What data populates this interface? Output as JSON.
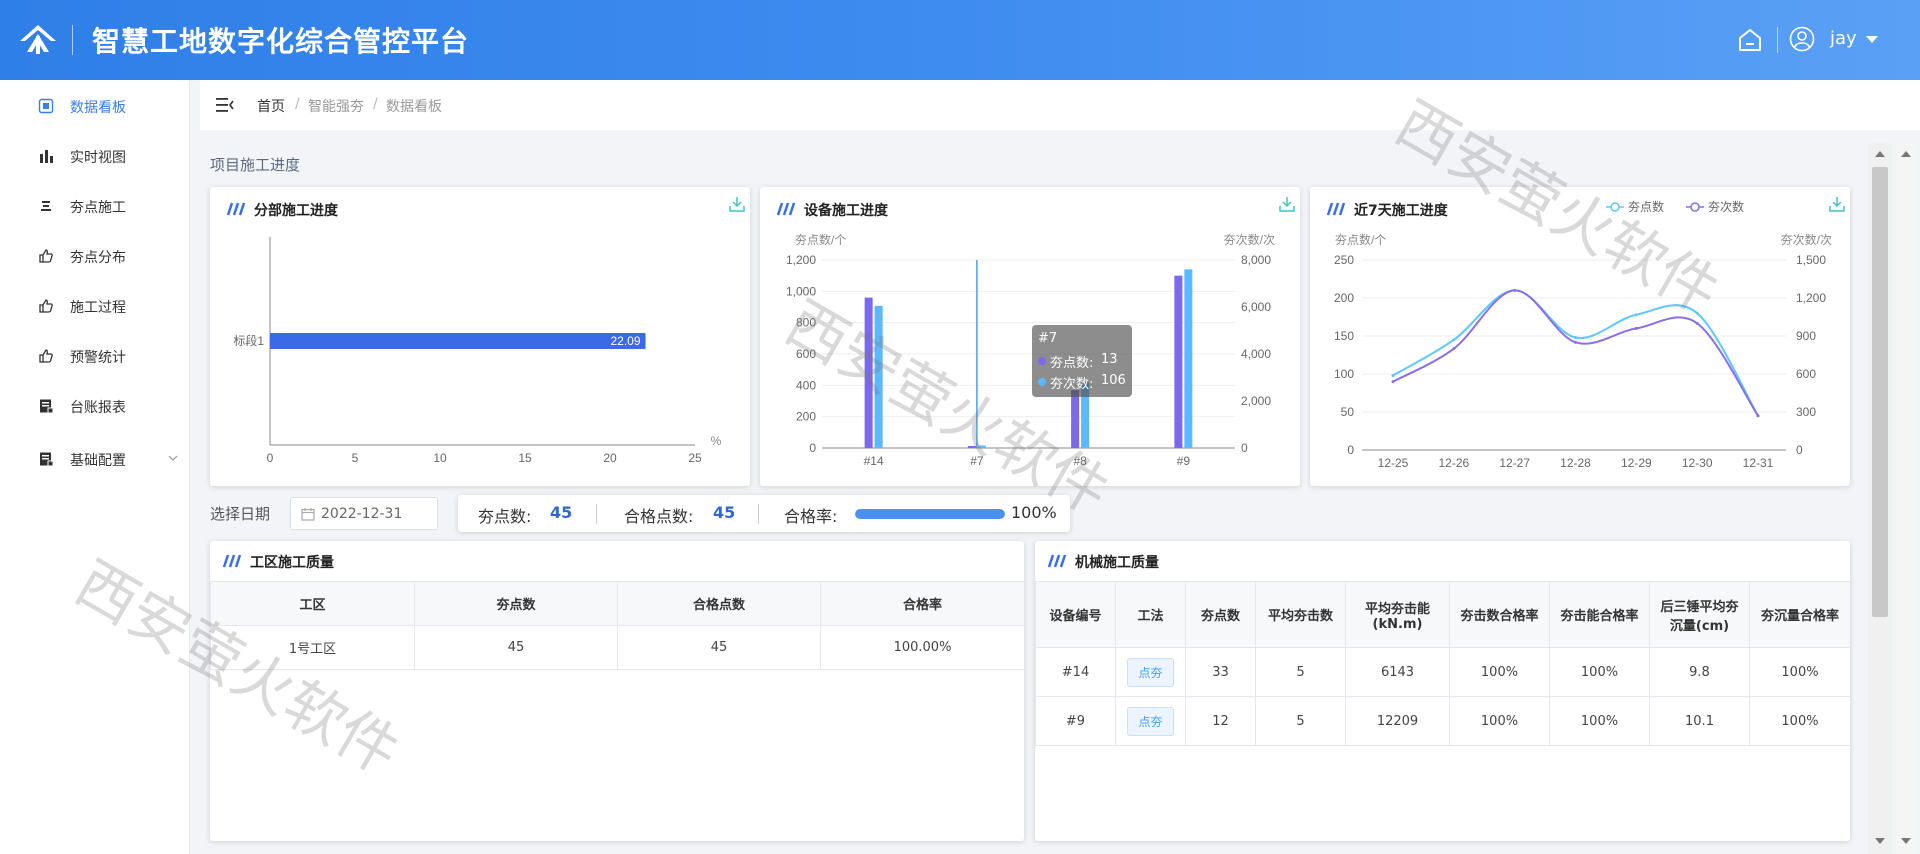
{
  "header": {
    "title": "智慧工地数字化综合管控平台",
    "user": "jay"
  },
  "sidebar": {
    "items": [
      {
        "label": "数据看板",
        "icon": "dashboard-icon",
        "active": true
      },
      {
        "label": "实时视图",
        "icon": "bar-chart-icon"
      },
      {
        "label": "夯点施工",
        "icon": "layers-icon"
      },
      {
        "label": "夯点分布",
        "icon": "thumbs-up-icon"
      },
      {
        "label": "施工过程",
        "icon": "thumbs-up-icon"
      },
      {
        "label": "预警统计",
        "icon": "thumbs-up-icon"
      },
      {
        "label": "台账报表",
        "icon": "report-icon"
      },
      {
        "label": "基础配置",
        "icon": "report-icon",
        "has_children": true
      }
    ]
  },
  "breadcrumb": [
    "首页",
    "智能强夯",
    "数据看板"
  ],
  "section_title": "项目施工进度",
  "cards": {
    "part_progress": {
      "title": "分部施工进度"
    },
    "equipment_progress": {
      "title": "设备施工进度",
      "tooltip": {
        "title": "#7",
        "rows": [
          {
            "label": "夯点数:",
            "value": "13"
          },
          {
            "label": "夯次数:",
            "value": "106"
          }
        ]
      }
    },
    "weekly_progress": {
      "title": "近7天施工进度"
    }
  },
  "chart_data": [
    {
      "type": "bar",
      "orientation": "horizontal",
      "categories": [
        "标段1"
      ],
      "values": [
        22.09
      ],
      "data_labels": [
        "22.09"
      ],
      "xlim": [
        0,
        25
      ],
      "xticks": [
        "0",
        "5",
        "10",
        "15",
        "20",
        "25"
      ],
      "xunit": "%",
      "color": "#3b6ae8"
    },
    {
      "type": "bar",
      "categories": [
        "#14",
        "#7",
        "#8",
        "#9"
      ],
      "ylabel": "夯点数/个",
      "ylabel_right": "夯次数/次",
      "ylim": [
        0,
        1200
      ],
      "ylim_right": [
        0,
        8000
      ],
      "yticks": [
        "0",
        "200",
        "400",
        "600",
        "800",
        "1,000",
        "1,200"
      ],
      "yticks_right": [
        "0",
        "2,000",
        "4,000",
        "6,000",
        "8,000"
      ],
      "series": [
        {
          "name": "夯点数",
          "axis": "left",
          "values": [
            960,
            13,
            370,
            1100
          ],
          "color": "#7b68ee"
        },
        {
          "name": "夯次数",
          "axis": "right",
          "values": [
            6050,
            106,
            2800,
            7600
          ],
          "color": "#5cb8ff"
        }
      ],
      "highlight_category": "#7"
    },
    {
      "type": "line",
      "x": [
        "12-25",
        "12-26",
        "12-27",
        "12-28",
        "12-29",
        "12-30",
        "12-31"
      ],
      "ylabel": "夯点数/个",
      "ylabel_right": "夯次数/次",
      "ylim": [
        0,
        250
      ],
      "ylim_right": [
        0,
        1500
      ],
      "yticks": [
        "0",
        "50",
        "100",
        "150",
        "200",
        "250"
      ],
      "yticks_right": [
        "0",
        "300",
        "600",
        "900",
        "1,200",
        "1,500"
      ],
      "legend_position": "top-right",
      "series": [
        {
          "name": "夯点数",
          "axis": "left",
          "values": [
            98,
            145,
            210,
            148,
            178,
            180,
            45
          ],
          "color": "#5cc8ff"
        },
        {
          "name": "夯次数",
          "axis": "right",
          "values": [
            540,
            800,
            1260,
            850,
            960,
            1000,
            270
          ],
          "color": "#8b6fe8"
        }
      ]
    }
  ],
  "filter": {
    "label": "选择日期",
    "date": "2022-12-31"
  },
  "stats": {
    "points_label": "夯点数:",
    "points_value": "45",
    "qualified_label": "合格点数:",
    "qualified_value": "45",
    "rate_label": "合格率:",
    "rate_value": "100%",
    "rate_fraction": 1.0
  },
  "zone_quality": {
    "title": "工区施工质量",
    "headers": [
      "工区",
      "夯点数",
      "合格点数",
      "合格率"
    ],
    "rows": [
      [
        "1号工区",
        "45",
        "45",
        "100.00%"
      ]
    ]
  },
  "machine_quality": {
    "title": "机械施工质量",
    "headers": [
      "设备编号",
      "工法",
      "夯点数",
      "平均夯击数",
      "平均夯击能(kN.m)",
      "夯击数合格率",
      "夯击能合格率",
      "后三锤平均夯沉量(cm)",
      "夯沉量合格率"
    ],
    "rows": [
      [
        "#14",
        "点夯",
        "33",
        "5",
        "6143",
        "100%",
        "100%",
        "9.8",
        "100%"
      ],
      [
        "#9",
        "点夯",
        "12",
        "5",
        "12209",
        "100%",
        "100%",
        "10.1",
        "100%"
      ]
    ]
  },
  "watermark": "西安萤火软件"
}
